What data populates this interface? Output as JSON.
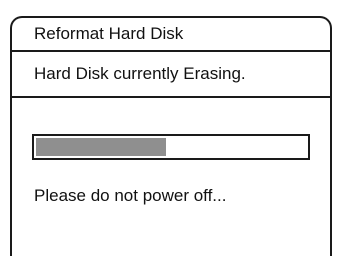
{
  "dialog": {
    "title": "Reformat Hard Disk",
    "status": "Hard Disk currently Erasing.",
    "progress_fraction": 0.48,
    "warning": "Please do not power off..."
  }
}
